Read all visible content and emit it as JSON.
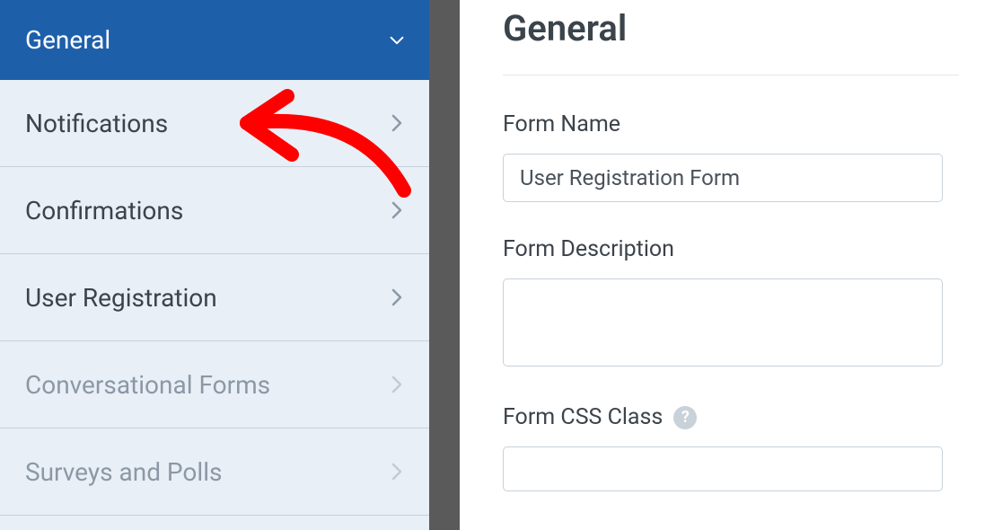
{
  "sidebar": {
    "items": [
      {
        "label": "General",
        "active": true
      },
      {
        "label": "Notifications"
      },
      {
        "label": "Confirmations"
      },
      {
        "label": "User Registration"
      },
      {
        "label": "Conversational Forms",
        "muted": true
      },
      {
        "label": "Surveys and Polls",
        "muted": true
      }
    ]
  },
  "main": {
    "title": "General",
    "form_name_label": "Form Name",
    "form_name_value": "User Registration Form",
    "form_description_label": "Form Description",
    "form_description_value": "",
    "form_css_class_label": "Form CSS Class",
    "form_css_class_value": ""
  },
  "annotation": {
    "color": "#ff0000"
  }
}
